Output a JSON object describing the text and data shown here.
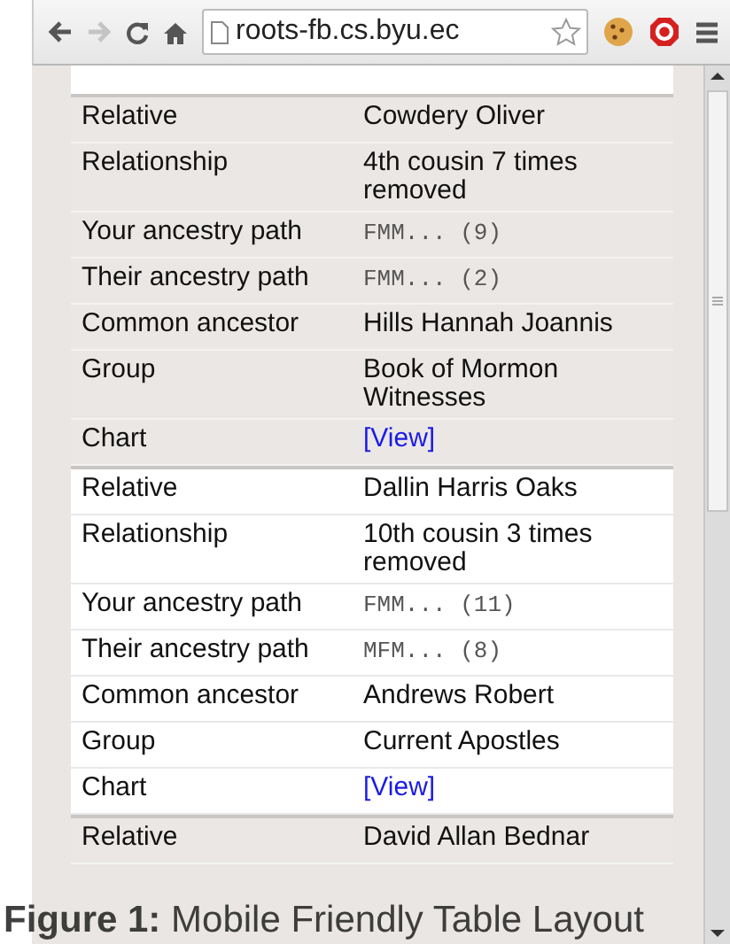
{
  "browser": {
    "url": "roots-fb.cs.byu.ec"
  },
  "table": {
    "groups": [
      {
        "shaded": true,
        "rows": [
          {
            "kind": "text",
            "label": "Relative",
            "value": "Cowdery Oliver"
          },
          {
            "kind": "text",
            "label": "Relationship",
            "value": "4th cousin 7 times removed"
          },
          {
            "kind": "path",
            "label": "Your ancestry path",
            "value": "FMM... (9)"
          },
          {
            "kind": "path",
            "label": "Their ancestry path",
            "value": "FMM... (2)"
          },
          {
            "kind": "text",
            "label": "Common ancestor",
            "value": "Hills Hannah Joannis"
          },
          {
            "kind": "text",
            "label": "Group",
            "value": "Book of Mormon Witnesses"
          },
          {
            "kind": "link",
            "label": "Chart",
            "value": "[View]"
          }
        ]
      },
      {
        "shaded": false,
        "rows": [
          {
            "kind": "text",
            "label": "Relative",
            "value": "Dallin Harris Oaks"
          },
          {
            "kind": "text",
            "label": "Relationship",
            "value": "10th cousin 3 times removed"
          },
          {
            "kind": "path",
            "label": "Your ancestry path",
            "value": "FMM... (11)"
          },
          {
            "kind": "path",
            "label": "Their ancestry path",
            "value": "MFM... (8)"
          },
          {
            "kind": "text",
            "label": "Common ancestor",
            "value": "Andrews Robert"
          },
          {
            "kind": "text",
            "label": "Group",
            "value": "Current Apostles"
          },
          {
            "kind": "link",
            "label": "Chart",
            "value": "[View]"
          }
        ]
      },
      {
        "shaded": true,
        "rows": [
          {
            "kind": "text",
            "label": "Relative",
            "value": "David Allan Bednar"
          }
        ]
      }
    ]
  },
  "caption": "**Figure 1:** Mobile Friendly Table Layout"
}
